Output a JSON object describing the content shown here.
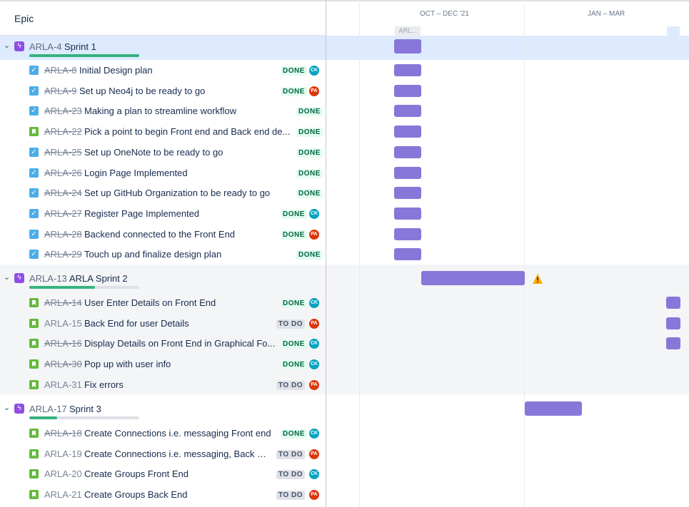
{
  "header": {
    "column_title": "Epic"
  },
  "timeline": {
    "quarters": [
      "OCT – DEC '21",
      "JAN – MAR"
    ],
    "tag_label": "ARL..."
  },
  "colors": {
    "bar": "#8777d9",
    "done_bg": "#e3fcef",
    "done_text": "#006644",
    "todo_bg": "#dfe1e6",
    "todo_text": "#42526e",
    "selected_row": "#deebff",
    "group_row": "#f4f5f7"
  },
  "epics": [
    {
      "key": "ARLA-4",
      "name": "Sprint 1",
      "progress": 1.0,
      "items": [
        {
          "key": "ARLA-8",
          "title": "Initial Design plan",
          "status": "DONE",
          "type": "task",
          "avatar": "CK"
        },
        {
          "key": "ARLA-9",
          "title": "Set up Neo4j to be ready to go",
          "status": "DONE",
          "type": "task",
          "avatar": "PA"
        },
        {
          "key": "ARLA-23",
          "title": "Making a plan to streamline workflow",
          "status": "DONE",
          "type": "task",
          "avatar": ""
        },
        {
          "key": "ARLA-22",
          "title": "Pick a point to begin Front end and Back end de...",
          "status": "DONE",
          "type": "story",
          "avatar": ""
        },
        {
          "key": "ARLA-25",
          "title": "Set up OneNote to be ready to go",
          "status": "DONE",
          "type": "task",
          "avatar": ""
        },
        {
          "key": "ARLA-26",
          "title": "Login Page Implemented",
          "status": "DONE",
          "type": "task",
          "avatar": ""
        },
        {
          "key": "ARLA-24",
          "title": "Set up GitHub Organization to be ready to go",
          "status": "DONE",
          "type": "task",
          "avatar": ""
        },
        {
          "key": "ARLA-27",
          "title": "Register Page Implemented",
          "status": "DONE",
          "type": "task",
          "avatar": "CK"
        },
        {
          "key": "ARLA-28",
          "title": "Backend connected to the Front End",
          "status": "DONE",
          "type": "task",
          "avatar": "PA"
        },
        {
          "key": "ARLA-29",
          "title": "Touch up and finalize design plan",
          "status": "DONE",
          "type": "task",
          "avatar": ""
        }
      ]
    },
    {
      "key": "ARLA-13",
      "name": "ARLA Sprint 2",
      "progress": 0.6,
      "items": [
        {
          "key": "ARLA-14",
          "title": "User Enter Details on Front End",
          "status": "DONE",
          "type": "story",
          "avatar": "CK"
        },
        {
          "key": "ARLA-15",
          "title": "Back End for user Details",
          "status": "TO DO",
          "type": "story",
          "avatar": "PA"
        },
        {
          "key": "ARLA-16",
          "title": "Display Details on Front End in Graphical Fo...",
          "status": "DONE",
          "type": "story",
          "avatar": "CK"
        },
        {
          "key": "ARLA-30",
          "title": "Pop up with user info",
          "status": "DONE",
          "type": "story",
          "avatar": "CK"
        },
        {
          "key": "ARLA-31",
          "title": "Fix errors",
          "status": "TO DO",
          "type": "story",
          "avatar": "PA"
        }
      ]
    },
    {
      "key": "ARLA-17",
      "name": "Sprint 3",
      "progress": 0.25,
      "items": [
        {
          "key": "ARLA-18",
          "title": "Create Connections i.e. messaging Front end",
          "status": "DONE",
          "type": "story",
          "avatar": "CK"
        },
        {
          "key": "ARLA-19",
          "title": "Create Connections i.e. messaging, Back End",
          "status": "TO DO",
          "type": "story",
          "avatar": "PA"
        },
        {
          "key": "ARLA-20",
          "title": "Create Groups Front End",
          "status": "TO DO",
          "type": "story",
          "avatar": "CK"
        },
        {
          "key": "ARLA-21",
          "title": "Create Groups Back End",
          "status": "TO DO",
          "type": "story",
          "avatar": "PA"
        }
      ]
    }
  ]
}
